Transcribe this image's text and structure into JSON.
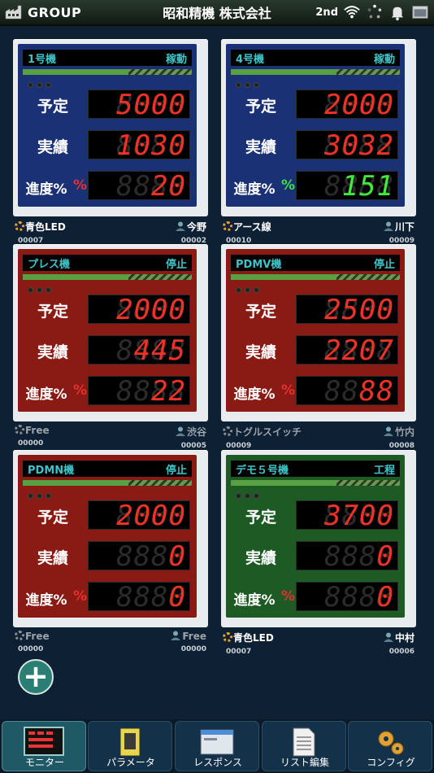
{
  "topbar": {
    "group_label": "GROUP",
    "company": "昭和精機 株式会社",
    "badge": "2nd",
    "icons": [
      "factory-icon",
      "wifi-icon",
      "loading-icon",
      "bell-icon",
      "window-icon"
    ]
  },
  "labels": {
    "plan": "予定",
    "actual": "実績",
    "progress": "進度%",
    "percent_sign": "%"
  },
  "machines": [
    {
      "name": "1号機",
      "status": "稼動",
      "panel_color": "#1b3176",
      "plan": "5000",
      "actual": "1030",
      "progress": "20",
      "progress_color": "red",
      "signal": "青色LED",
      "signal_id": "00007",
      "operator": "今野",
      "operator_id": "00002",
      "signal_active": true
    },
    {
      "name": "4号機",
      "status": "稼動",
      "panel_color": "#1b3176",
      "plan": "2000",
      "actual": "3032",
      "progress": "151",
      "progress_color": "green",
      "signal": "アース線",
      "signal_id": "00010",
      "operator": "川下",
      "operator_id": "00009",
      "signal_active": true
    },
    {
      "name": "プレス機",
      "status": "停止",
      "panel_color": "#8a1a14",
      "plan": "2000",
      "actual": "445",
      "progress": "22",
      "progress_color": "red",
      "signal": "Free",
      "signal_id": "00000",
      "operator": "渋谷",
      "operator_id": "00005",
      "signal_active": false
    },
    {
      "name": "PDMV機",
      "status": "停止",
      "panel_color": "#8a1a14",
      "plan": "2500",
      "actual": "2207",
      "progress": "88",
      "progress_color": "red",
      "signal": "トグルスイッチ",
      "signal_id": "00009",
      "operator": "竹内",
      "operator_id": "00008",
      "signal_active": false
    },
    {
      "name": "PDMN機",
      "status": "停止",
      "panel_color": "#8a1a14",
      "plan": "2000",
      "actual": "0",
      "progress": "0",
      "progress_color": "red",
      "signal": "Free",
      "signal_id": "00000",
      "operator": "Free",
      "operator_id": "00000",
      "signal_active": false
    },
    {
      "name": "デモ５号機",
      "status": "工程",
      "panel_color": "#1d5a24",
      "plan": "3700",
      "actual": "0",
      "progress": "0",
      "progress_color": "red",
      "signal": "青色LED",
      "signal_id": "00007",
      "operator": "中村",
      "operator_id": "00006",
      "signal_active": true
    }
  ],
  "fab_label": "+",
  "tabs": [
    {
      "label": "モニター",
      "active": true,
      "icon": "monitor-icon"
    },
    {
      "label": "パラメータ",
      "active": false,
      "icon": "parameter-icon"
    },
    {
      "label": "レスポンス",
      "active": false,
      "icon": "response-icon"
    },
    {
      "label": "リスト編集",
      "active": false,
      "icon": "list-edit-icon"
    },
    {
      "label": "コンフィグ",
      "active": false,
      "icon": "config-icon"
    }
  ]
}
